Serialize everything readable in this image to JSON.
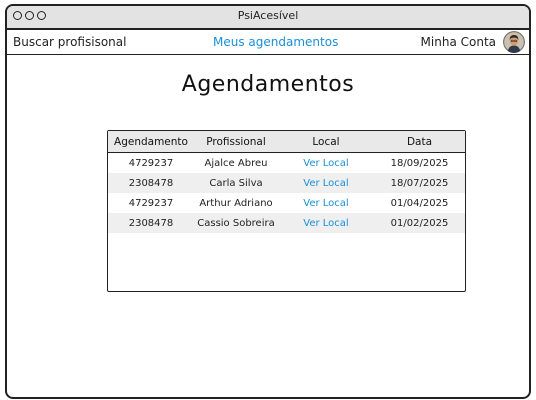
{
  "window": {
    "title": "PsiAcesível"
  },
  "navbar": {
    "search_label": "Buscar profisisonal",
    "appointments_label": "Meus agendamentos",
    "account_label": "Minha Conta"
  },
  "page": {
    "title": "Agendamentos"
  },
  "table": {
    "headers": [
      "Agendamento",
      "Profissional",
      "Local",
      "Data"
    ],
    "rows": [
      {
        "id": "4729237",
        "professional": "Ajalce Abreu",
        "location": "Ver Local",
        "date": "18/09/2025"
      },
      {
        "id": "2308478",
        "professional": "Carla Silva",
        "location": "Ver Local",
        "date": "18/07/2025"
      },
      {
        "id": "4729237",
        "professional": "Arthur Adriano",
        "location": "Ver Local",
        "date": "01/04/2025"
      },
      {
        "id": "2308478",
        "professional": "Cassio Sobreira",
        "location": "Ver Local",
        "date": "01/02/2025"
      }
    ]
  },
  "colors": {
    "accent": "#1a90d8",
    "row_shade": "#efefef",
    "header_bg": "#e9e9e9",
    "titlebar_bg": "#e3e3e3"
  }
}
